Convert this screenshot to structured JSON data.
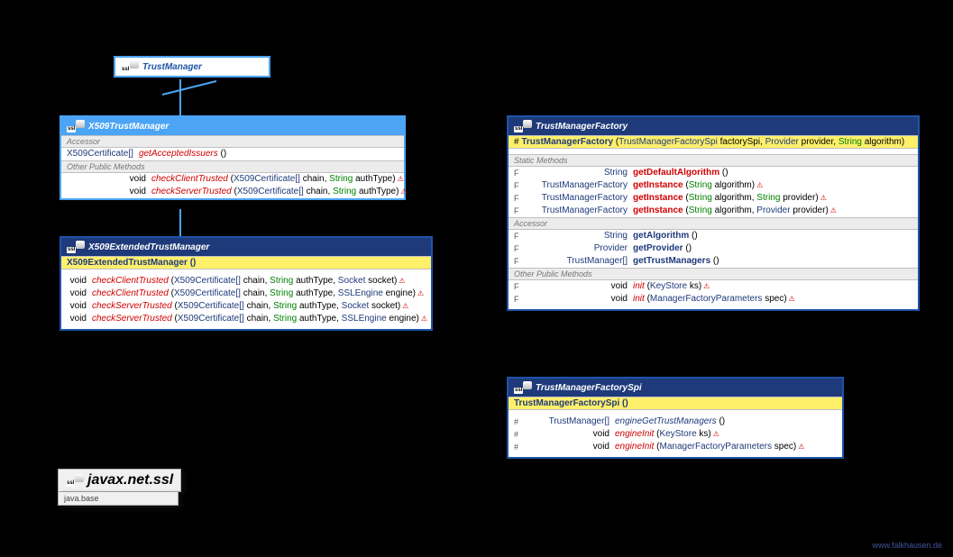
{
  "package": {
    "name": "javax.net.ssl",
    "module": "java.base"
  },
  "footer": "www.falkhausen.de",
  "tm": {
    "title": "TrustManager"
  },
  "x509": {
    "title": "X509TrustManager",
    "sect_acc": "Accessor",
    "sect_pub": "Other Public Methods",
    "acc": [
      {
        "ret": "X509Certificate[]",
        "name": "getAcceptedIssuers",
        "params": "()"
      }
    ],
    "pub": [
      {
        "ret": "void",
        "name": "checkClientTrusted",
        "p1": "(X509Certificate[] chain,",
        "p2": " String",
        "p3": " authType)"
      },
      {
        "ret": "void",
        "name": "checkServerTrusted",
        "p1": "(X509Certificate[] chain,",
        "p2": " String",
        "p3": " authType)"
      }
    ]
  },
  "ext": {
    "title": "X509ExtendedTrustManager",
    "ctor": "X509ExtendedTrustManager ()",
    "rows": [
      {
        "ret": "void",
        "name": "checkClientTrusted",
        "sig": "(X509Certificate[] chain, String authType, Socket socket)"
      },
      {
        "ret": "void",
        "name": "checkClientTrusted",
        "sig": "(X509Certificate[] chain, String authType, SSLEngine engine)"
      },
      {
        "ret": "void",
        "name": "checkServerTrusted",
        "sig": "(X509Certificate[] chain, String authType, Socket socket)"
      },
      {
        "ret": "void",
        "name": "checkServerTrusted",
        "sig": "(X509Certificate[] chain, String authType, SSLEngine engine)"
      }
    ]
  },
  "tmf": {
    "title": "TrustManagerFactory",
    "ctor": {
      "vis": "#",
      "name": "TrustManagerFactory",
      "sig": " (TrustManagerFactorySpi factorySpi, Provider provider, String algorithm)"
    },
    "sect_static": "Static Methods",
    "sect_acc": "Accessor",
    "sect_pub": "Other Public Methods",
    "st": [
      {
        "mod": "F",
        "ret": "String",
        "name": "getDefaultAlgorithm",
        "sig": "()"
      },
      {
        "mod": "F",
        "ret": "TrustManagerFactory",
        "name": "getInstance",
        "sig": "(String algorithm)",
        "thr": true
      },
      {
        "mod": "F",
        "ret": "TrustManagerFactory",
        "name": "getInstance",
        "sig": "(String algorithm, String provider)",
        "thr": true
      },
      {
        "mod": "F",
        "ret": "TrustManagerFactory",
        "name": "getInstance",
        "sig": "(String algorithm, Provider provider)",
        "thr": true
      }
    ],
    "ac": [
      {
        "mod": "F",
        "ret": "String",
        "name": "getAlgorithm",
        "sig": "()"
      },
      {
        "mod": "F",
        "ret": "Provider",
        "name": "getProvider",
        "sig": "()"
      },
      {
        "mod": "F",
        "ret": "TrustManager[]",
        "name": "getTrustManagers",
        "sig": "()"
      }
    ],
    "pb": [
      {
        "mod": "F",
        "ret": "void",
        "name": "init",
        "sig": "(KeyStore ks)",
        "thr": true
      },
      {
        "mod": "F",
        "ret": "void",
        "name": "init",
        "sig": "(ManagerFactoryParameters spec)",
        "thr": true
      }
    ]
  },
  "spi": {
    "title": "TrustManagerFactorySpi",
    "ctor": "TrustManagerFactorySpi ()",
    "rows": [
      {
        "mod": "#",
        "ret": "TrustManager[]",
        "name": "engineGetTrustManagers",
        "sig": "()",
        "red": false
      },
      {
        "mod": "#",
        "ret": "void",
        "name": "engineInit",
        "sig": "(KeyStore ks)",
        "red": true,
        "thr": true
      },
      {
        "mod": "#",
        "ret": "void",
        "name": "engineInit",
        "sig": "(ManagerFactoryParameters spec)",
        "red": true,
        "thr": true
      }
    ]
  }
}
